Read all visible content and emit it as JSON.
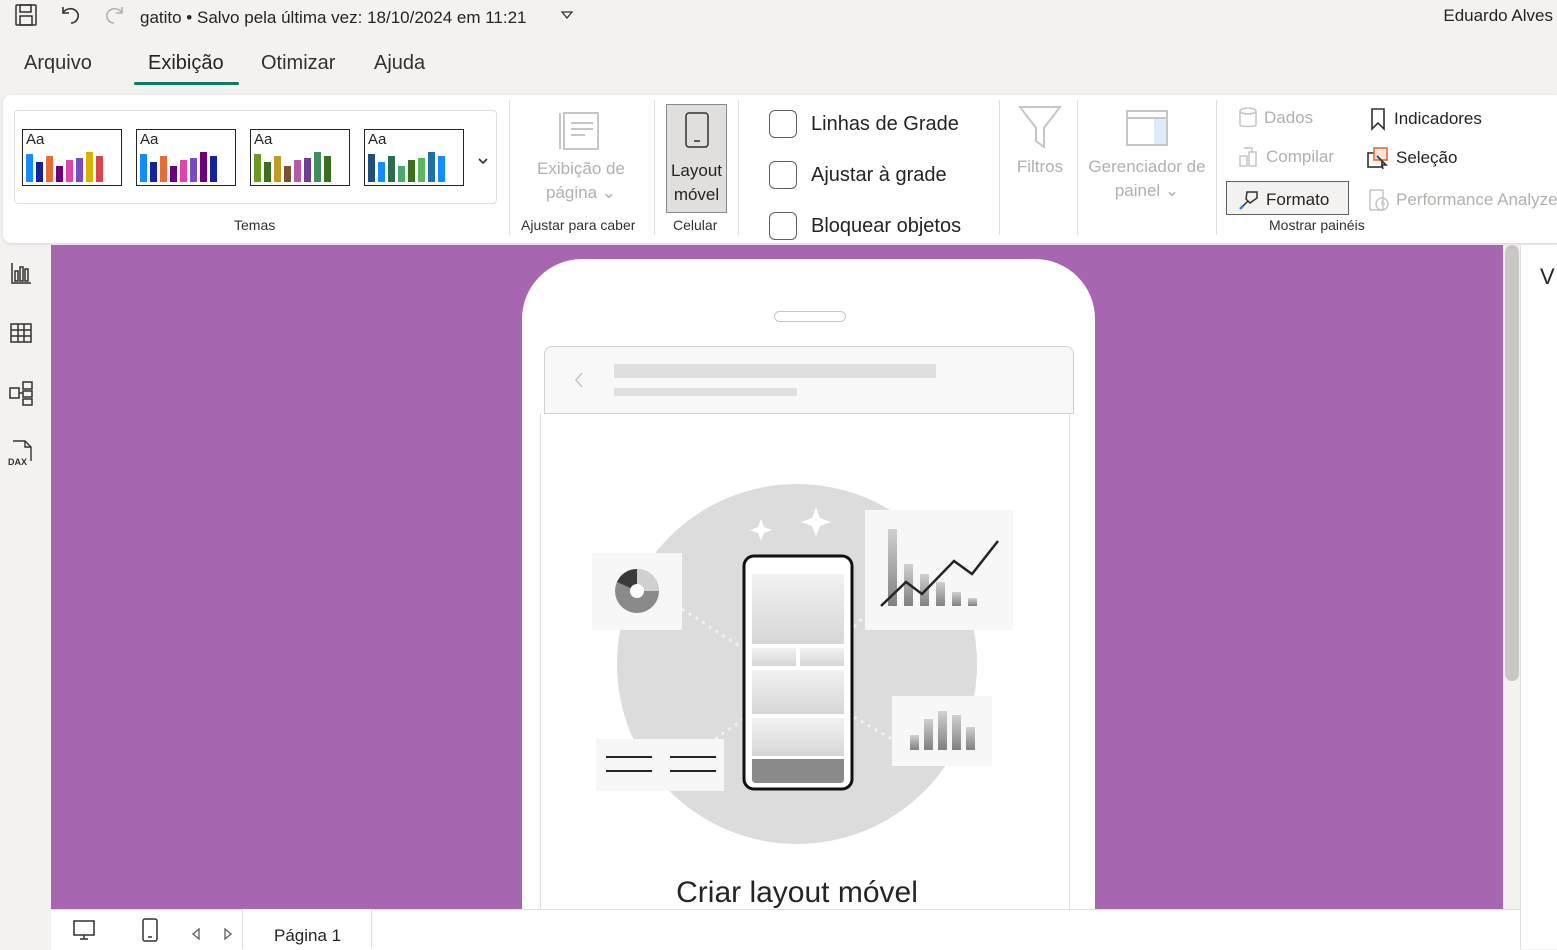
{
  "titlebar": {
    "title": "gatito • Salvo pela última vez: 18/10/2024 em 11:21",
    "user": "Eduardo Alves"
  },
  "menu": {
    "tabs": [
      {
        "label": "Arquivo"
      },
      {
        "label": "Exibição",
        "active": true
      },
      {
        "label": "Otimizar"
      },
      {
        "label": "Ajuda"
      }
    ]
  },
  "ribbon": {
    "themes": {
      "label": "Temas",
      "items": [
        {
          "text": "Aa",
          "colors": [
            "#118dff",
            "#12239e",
            "#e66c37",
            "#6b007b",
            "#e044a7",
            "#744ec2",
            "#d9b300",
            "#d64550"
          ]
        },
        {
          "text": "Aa",
          "colors": [
            "#118dff",
            "#12239e",
            "#e66c37",
            "#6b007b",
            "#e044a7",
            "#744ec2",
            "#6b007b",
            "#12239e"
          ]
        },
        {
          "text": "Aa",
          "colors": [
            "#6a9a1f",
            "#3b6e1f",
            "#c19a27",
            "#7a5233",
            "#b45aa8",
            "#6e3f92",
            "#3f8f5c",
            "#3b6e1f"
          ]
        },
        {
          "text": "Aa",
          "colors": [
            "#1f4e79",
            "#118dff",
            "#2e6b4f",
            "#4aa86a",
            "#3b6e1f",
            "#5cb85c",
            "#1f6fa8",
            "#118dff"
          ]
        }
      ]
    },
    "page_view": {
      "label_line1": "Exibição de",
      "label_line2": "página",
      "group": "Ajustar para caber"
    },
    "mobile_layout": {
      "label_line1": "Layout",
      "label_line2": "móvel",
      "group": "Celular"
    },
    "checkboxes": [
      {
        "label": "Linhas de Grade"
      },
      {
        "label": "Ajustar à grade"
      },
      {
        "label": "Bloquear objetos"
      }
    ],
    "filters": {
      "label": "Filtros"
    },
    "panel_manager": {
      "label_line1": "Gerenciador de",
      "label_line2": "painel"
    },
    "panes": {
      "group": "Mostrar painéis",
      "dados": "Dados",
      "compilar": "Compilar",
      "formato": "Formato",
      "indicadores": "Indicadores",
      "selecao": "Seleção",
      "performance": "Performance Analyzer"
    }
  },
  "canvas": {
    "background": "#a667b0",
    "create_title": "Criar layout móvel"
  },
  "right_pane": {
    "letter": "V"
  },
  "bottom": {
    "page_tab": "Página 1"
  }
}
